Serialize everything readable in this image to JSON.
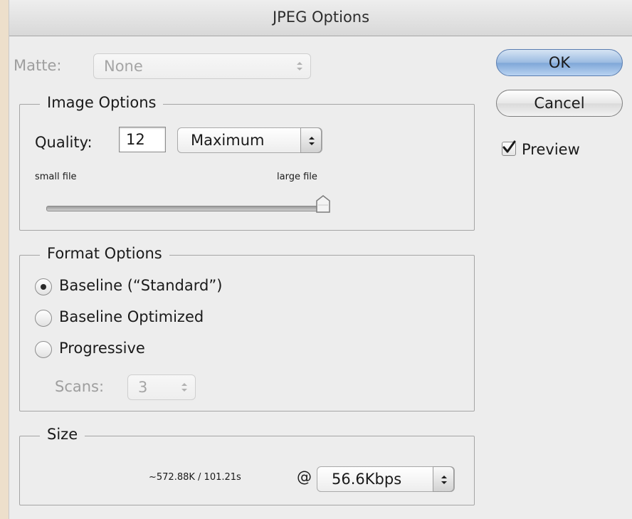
{
  "window": {
    "title": "JPEG Options"
  },
  "matte": {
    "label": "Matte:",
    "value": "None"
  },
  "image_options": {
    "title": "Image Options",
    "quality_label": "Quality:",
    "quality_value": "12",
    "quality_preset": "Maximum",
    "slider_min_label": "small file",
    "slider_max_label": "large file",
    "slider_level": 1.0
  },
  "format_options": {
    "title": "Format Options",
    "options": [
      {
        "label": "Baseline (“Standard”)",
        "selected": true
      },
      {
        "label": "Baseline Optimized",
        "selected": false
      },
      {
        "label": "Progressive",
        "selected": false
      }
    ],
    "scans_label": "Scans:",
    "scans_value": "3"
  },
  "size": {
    "title": "Size",
    "estimate": "~572.88K / 101.21s",
    "at": "@",
    "speed": "56.6Kbps"
  },
  "buttons": {
    "ok": "OK",
    "cancel": "Cancel"
  },
  "preview": {
    "label": "Preview",
    "checked": true
  },
  "icons": {
    "popup_arrows": "up-down-chevron-icon",
    "checkmark": "checkmark-icon",
    "slider_thumb": "slider-thumb-icon"
  }
}
